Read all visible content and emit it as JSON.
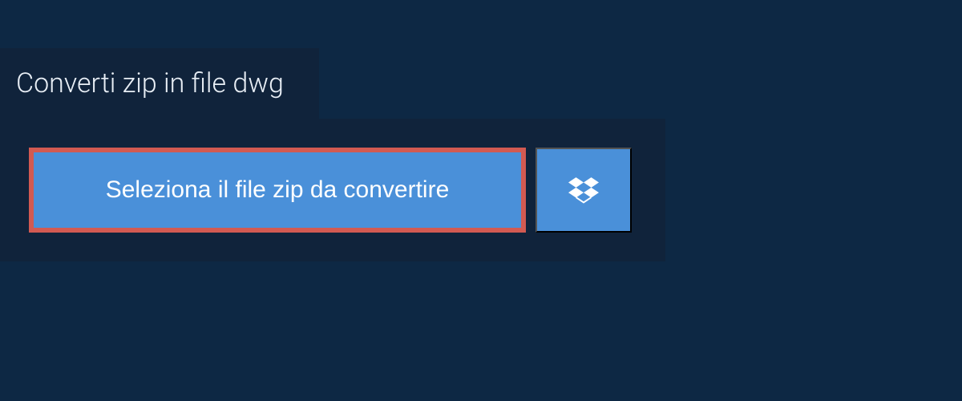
{
  "header": {
    "title": "Converti zip in file dwg"
  },
  "upload": {
    "select_file_label": "Seleziona il file zip da convertire",
    "dropbox_icon_name": "dropbox-icon"
  },
  "colors": {
    "background": "#0d2844",
    "panel": "#10233b",
    "button": "#4a90d9",
    "highlight_border": "#d25a52",
    "text_light": "#e8eef5"
  }
}
